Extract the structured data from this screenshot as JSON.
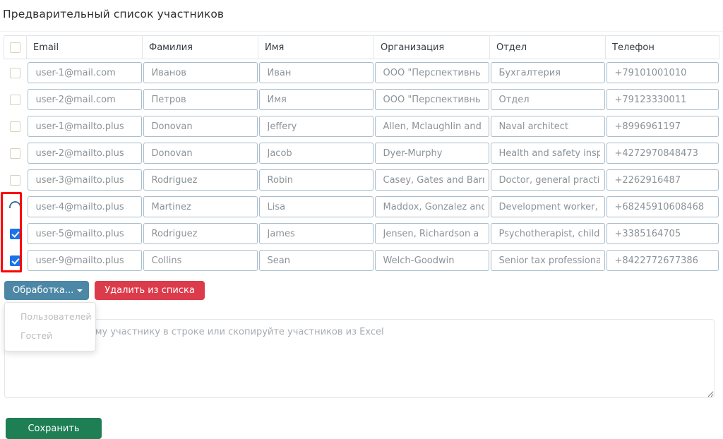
{
  "page": {
    "title": "Предварительный список участников"
  },
  "table": {
    "select_all_checkbox": "unchecked",
    "columns": [
      {
        "key": "select",
        "label": ""
      },
      {
        "key": "email",
        "label": "Email"
      },
      {
        "key": "lastname",
        "label": "Фамилия"
      },
      {
        "key": "firstname",
        "label": "Имя"
      },
      {
        "key": "organization",
        "label": "Организация"
      },
      {
        "key": "department",
        "label": "Отдел"
      },
      {
        "key": "phone",
        "label": "Телефон"
      }
    ],
    "rows": [
      {
        "state": "unchecked",
        "email": "user-1@mail.com",
        "lastname": "Иванов",
        "firstname": "Иван",
        "organization": "ООО \"Перспективнь",
        "department": "Бухгалтерия",
        "phone": "+79101001010"
      },
      {
        "state": "unchecked",
        "email": "user-2@mail.com",
        "lastname": "Петров",
        "firstname": "Имя",
        "organization": "ООО \"Перспективнь",
        "department": "Отдел",
        "phone": "+79123330011"
      },
      {
        "state": "unchecked",
        "email": "user-1@mailto.plus",
        "lastname": "Donovan",
        "firstname": "Jeffery",
        "organization": "Allen, Mclaughlin and",
        "department": "Naval architect",
        "phone": "+8996961197"
      },
      {
        "state": "unchecked",
        "email": "user-2@mailto.plus",
        "lastname": "Donovan",
        "firstname": "Jacob",
        "organization": "Dyer-Murphy",
        "department": "Health and safety insp",
        "phone": "+4272970848473"
      },
      {
        "state": "unchecked",
        "email": "user-3@mailto.plus",
        "lastname": "Rodriguez",
        "firstname": "Robin",
        "organization": "Casey, Gates and Barn",
        "department": "Doctor, general practit",
        "phone": "+2262916487"
      },
      {
        "state": "loading",
        "email": "user-4@mailto.plus",
        "lastname": "Martinez",
        "firstname": "Lisa",
        "organization": "Maddox, Gonzalez and",
        "department": "Development worker, c",
        "phone": "+68245910608468"
      },
      {
        "state": "checked",
        "email": "user-5@mailto.plus",
        "lastname": "Rodriguez",
        "firstname": "James",
        "organization": "Jensen, Richardson a",
        "department": "Psychotherapist, child",
        "phone": "+3385164705"
      },
      {
        "state": "checked",
        "email": "user-9@mailto.plus",
        "lastname": "Collins",
        "firstname": "Sean",
        "organization": "Welch-Goodwin",
        "department": "Senior tax professiona",
        "phone": "+8422772677386"
      }
    ]
  },
  "actions": {
    "process_label": "Обработка...",
    "delete_label": "Удалить из списка",
    "dropdown_items": [
      {
        "label": "Пользователей",
        "disabled": true
      },
      {
        "label": "Гостей",
        "disabled": true
      }
    ]
  },
  "excel_input": {
    "placeholder": "Введите по одному участнику в строке или скопируйте участников из Excel",
    "value": ""
  },
  "footer": {
    "save_label": "Сохранить"
  },
  "colors": {
    "process_button": "#4c87a6",
    "delete_button": "#dc3b4b",
    "save_button": "#1e7e54",
    "checkbox_checked": "#1a73e8",
    "annotation": "#ff0000",
    "input_border": "#a9bdcc"
  }
}
